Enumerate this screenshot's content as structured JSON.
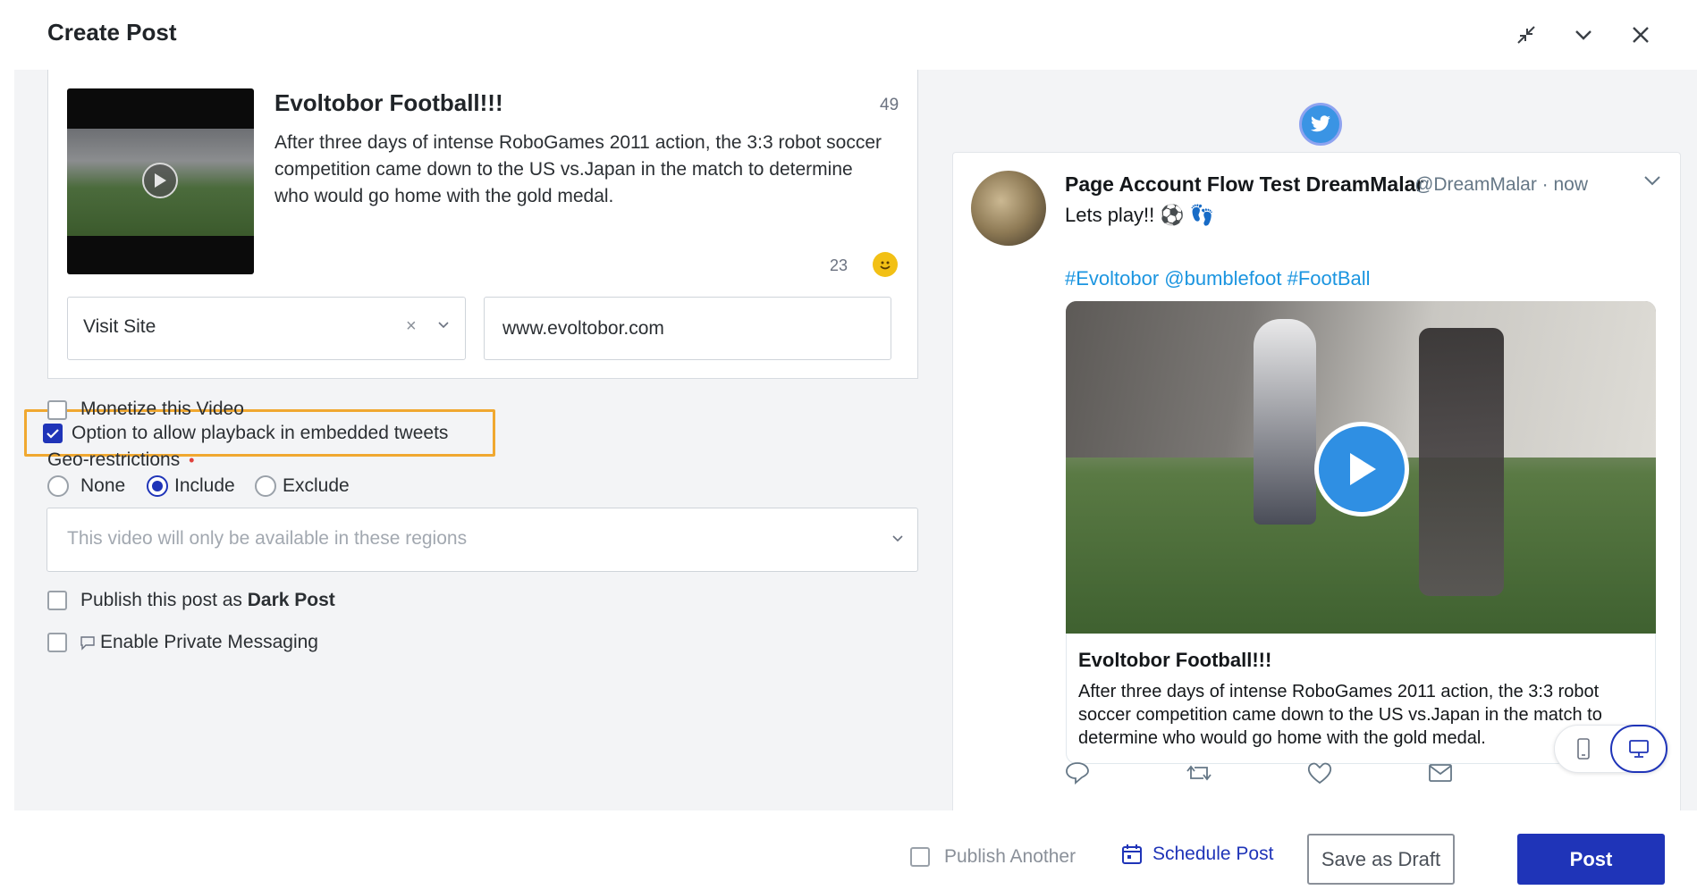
{
  "header": {
    "title": "Create Post"
  },
  "post_card": {
    "title": "Evoltobor Football!!!",
    "title_count": "49",
    "description": "After three days of intense RoboGames 2011 action, the 3:3 robot soccer competition came down to the US vs.Japan in the match to determine who would go home with the gold medal.",
    "description_count": "23",
    "cta_select_value": "Visit Site",
    "cta_clear_symbol": "×",
    "url_value": "www.evoltobor.com"
  },
  "options": {
    "playback_label": "Option to allow playback in embedded tweets",
    "playback_checked": true,
    "monetize_label": "Monetize this Video",
    "monetize_checked": false,
    "geo_label": "Geo-restrictions",
    "geo_required_mark": "•",
    "geo_options": [
      {
        "label": "None",
        "selected": false
      },
      {
        "label": "Include",
        "selected": true
      },
      {
        "label": "Exclude",
        "selected": false
      }
    ],
    "region_placeholder": "This video will only be available in these regions",
    "dark_post_prefix": "Publish this post as ",
    "dark_post_bold": "Dark Post",
    "private_messaging_label": "Enable Private Messaging"
  },
  "preview": {
    "account_name": "Page Account Flow Test DreamMalar",
    "handle": "@DreamMalar · now",
    "text": "Lets play!! ⚽ 👣",
    "hashtags": "#Evoltobor @bumblefoot #FootBall",
    "link_title": "Evoltobor Football!!!",
    "link_description": "After three days of intense RoboGames 2011 action, the 3:3 robot soccer competition came down to the US vs.Japan in the match to determine who would go home with the gold medal."
  },
  "footer": {
    "publish_another": "Publish Another",
    "schedule_post": "Schedule Post",
    "save_draft": "Save as Draft",
    "post": "Post"
  },
  "colors": {
    "primary": "#1f34b8",
    "highlight_border": "#f0a830",
    "twitter_blue": "#1b95e0",
    "panel_bg": "#f3f4f6"
  },
  "icons": [
    "collapse-icon",
    "chevron-down-icon",
    "close-icon",
    "play-icon",
    "smiley-icon",
    "twitter-bird-icon",
    "reply-icon",
    "retweet-icon",
    "like-icon",
    "share-mail-icon",
    "mobile-icon",
    "desktop-icon",
    "calendar-icon",
    "message-icon"
  ]
}
